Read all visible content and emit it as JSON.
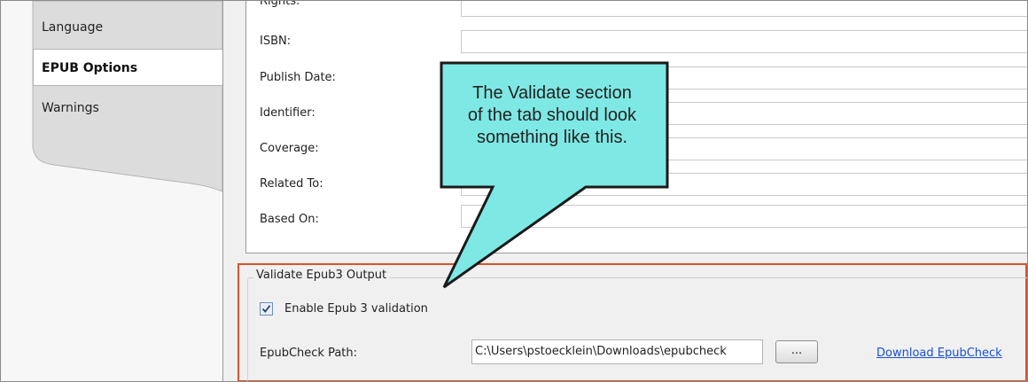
{
  "tabs": {
    "items": [
      {
        "label": "Language"
      },
      {
        "label": "EPUB Options"
      },
      {
        "label": "Warnings"
      }
    ]
  },
  "properties": {
    "rows": [
      {
        "label": "Rights:"
      },
      {
        "label": "ISBN:"
      },
      {
        "label": "Publish Date:"
      },
      {
        "label": "Identifier:"
      },
      {
        "label": "Coverage:"
      },
      {
        "label": "Related To:"
      },
      {
        "label": "Based On:"
      }
    ]
  },
  "validate": {
    "group_title": "Validate Epub3 Output",
    "enable_label": "Enable Epub 3 validation",
    "enable_checked": true,
    "path_label": "EpubCheck Path:",
    "path_value": "C:\\Users\\pstoecklein\\Downloads\\epubcheck",
    "browse_label": "...",
    "download_link": "Download EpubCheck"
  },
  "callout": {
    "text_lines": [
      "The Validate section",
      "of the tab should look",
      "something like this."
    ]
  },
  "colors": {
    "highlight_border": "#d9532b",
    "callout_fill": "#7ee8e4",
    "link": "#1a4fd6"
  }
}
